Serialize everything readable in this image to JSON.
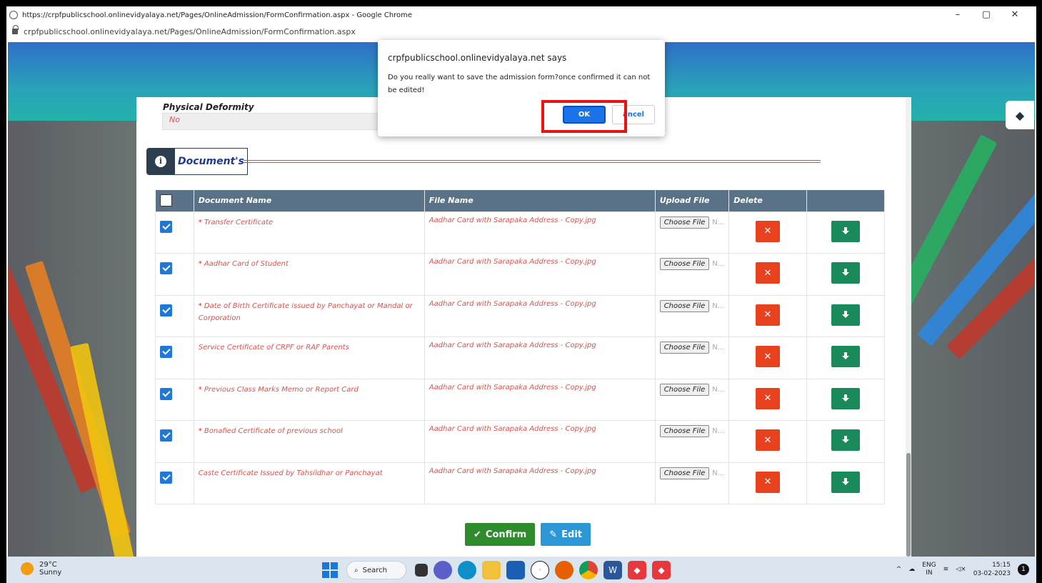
{
  "browser": {
    "window_title": "https://crpfpublicschool.onlinevidyalaya.net/Pages/OnlineAdmission/FormConfirmation.aspx - Google Chrome",
    "address": "crpfpublicschool.onlinevidyalaya.net/Pages/OnlineAdmission/FormConfirmation.aspx",
    "minimize": "–",
    "maximize": "▢",
    "close": "✕"
  },
  "form": {
    "physical_deformity_label": "Physical Deformity",
    "physical_deformity_value": "No",
    "documents_title": "Document's"
  },
  "table": {
    "headers": [
      "Document Name",
      "File Name",
      "Upload File",
      "Delete",
      ""
    ],
    "choose_file_label": "Choose File",
    "no_file_label": "N...",
    "rows": [
      {
        "required": true,
        "name": "Transfer Certificate",
        "file": "Aadhar Card with Sarapaka Address - Copy.jpg"
      },
      {
        "required": true,
        "name": "Aadhar Card of Student",
        "file": "Aadhar Card with Sarapaka Address - Copy.jpg"
      },
      {
        "required": true,
        "name": "Date of Birth Certificate issued by Panchayat or Mandal or Corporation",
        "file": "Aadhar Card with Sarapaka Address - Copy.jpg"
      },
      {
        "required": false,
        "name": "Service Certificate of CRPF or RAF Parents",
        "file": "Aadhar Card with Sarapaka Address - Copy.jpg"
      },
      {
        "required": true,
        "name": "Previous Class Marks Memo or Report Card",
        "file": "Aadhar Card with Sarapaka Address - Copy.jpg"
      },
      {
        "required": true,
        "name": "Bonafied Certificate of previous school",
        "file": "Aadhar Card with Sarapaka Address - Copy.jpg"
      },
      {
        "required": false,
        "name": "Caste Certificate Issued by Tahsildhar or Panchayat",
        "file": "Aadhar Card with Sarapaka Address - Copy.jpg"
      }
    ]
  },
  "actions": {
    "confirm_label": "Confirm",
    "edit_label": "Edit"
  },
  "dialog": {
    "title": "crpfpublicschool.onlinevidyalaya.net says",
    "message": "Do you really want to save the admission form?once confirmed it can not be edited!",
    "ok_label": "OK",
    "cancel_label": "ancel"
  },
  "taskbar": {
    "temperature": "29°C",
    "weather": "Sunny",
    "search_label": "Search",
    "lang_top": "ENG",
    "lang_bottom": "IN",
    "time": "15:15",
    "date": "03-02-2023",
    "notification_count": "1"
  },
  "colors": {
    "banner": "#2a9fbb",
    "header": "#5a7287",
    "delete": "#e8411e",
    "download": "#1a8a5a",
    "confirm": "#2e8b2e",
    "edit": "#2d97d6",
    "ok": "#1a73e8",
    "highlight": "#ee1111"
  }
}
